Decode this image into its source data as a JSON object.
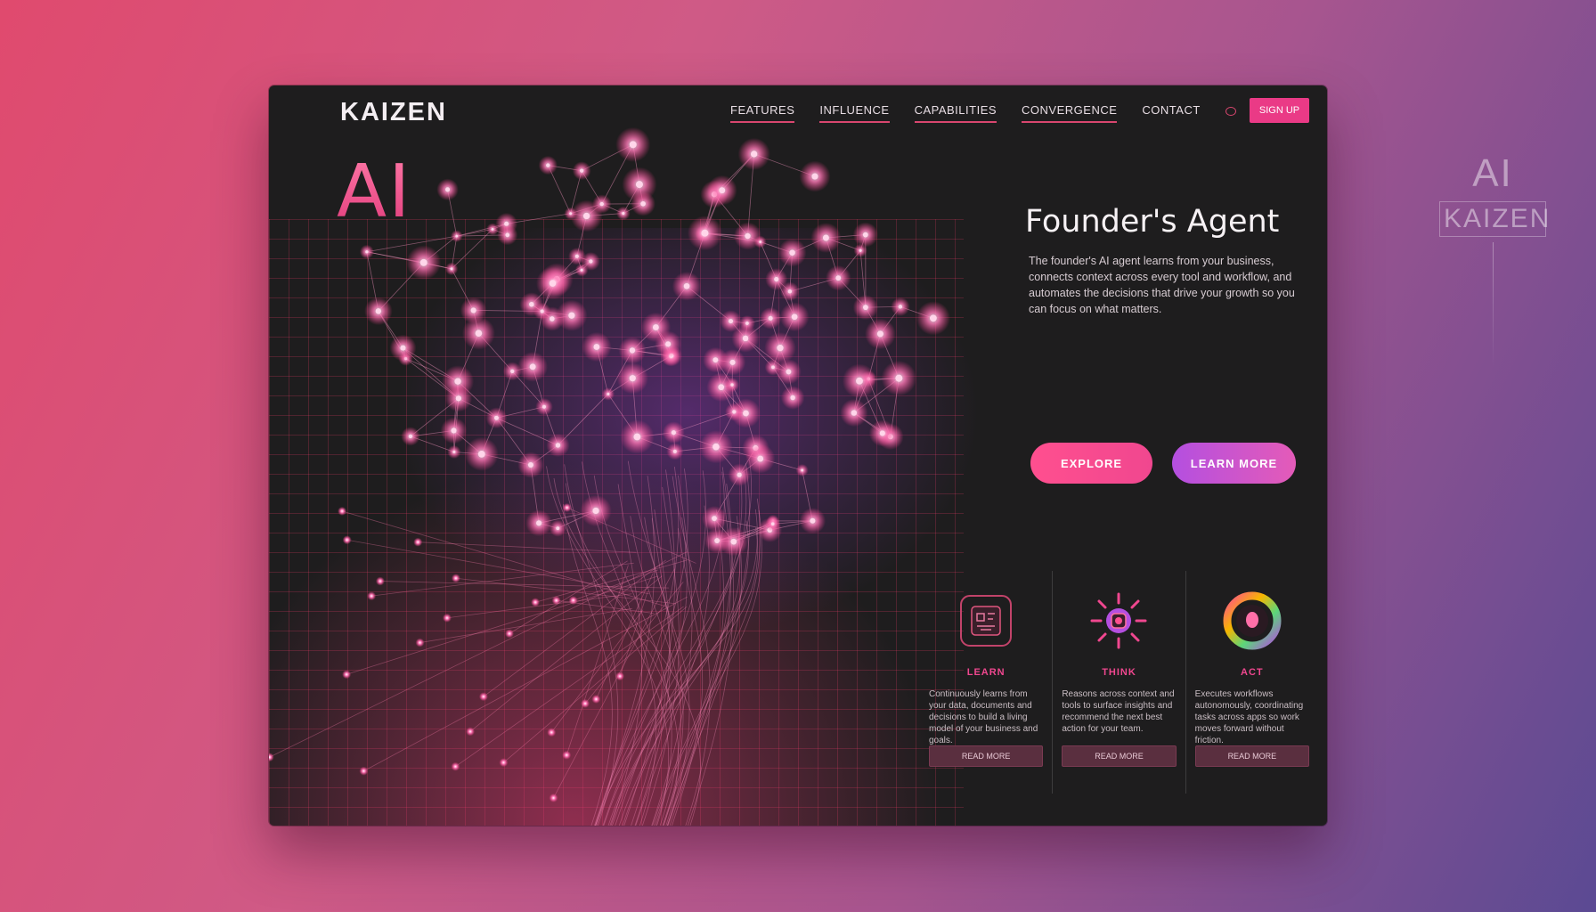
{
  "side_brand": {
    "ai": "AI",
    "kaizen": "KAIZEN"
  },
  "nav": {
    "logo": "KAIZEN",
    "items": [
      "FEATURES",
      "INFLUENCE",
      "CAPABILITIES",
      "CONVERGENCE",
      "CONTACT"
    ],
    "cta": "SIGN UP"
  },
  "hero": {
    "ai_title": "AI",
    "headline": "Founder's Agent",
    "description": "The founder's AI agent learns from your business, connects context across every tool and workflow, and automates the decisions that drive your growth so you can focus on what matters.",
    "primary_button": "EXPLORE",
    "secondary_button": "LEARN MORE"
  },
  "features": [
    {
      "icon": "circuit-chip-icon",
      "title": "LEARN",
      "text": "Continuously learns from your data, documents and decisions to build a living model of your business and goals.",
      "button": "READ MORE"
    },
    {
      "icon": "neural-burst-icon",
      "title": "THINK",
      "text": "Reasons across context and tools to surface insights and recommend the next best action for your team.",
      "button": "READ MORE"
    },
    {
      "icon": "gradient-ring-icon",
      "title": "ACT",
      "text": "Executes workflows autonomously, coordinating tasks across apps so work moves forward without friction.",
      "button": "READ MORE"
    }
  ],
  "colors": {
    "accent": "#ea3a86",
    "accent_secondary": "#b44fe0",
    "window_bg": "#1e1d1e"
  }
}
